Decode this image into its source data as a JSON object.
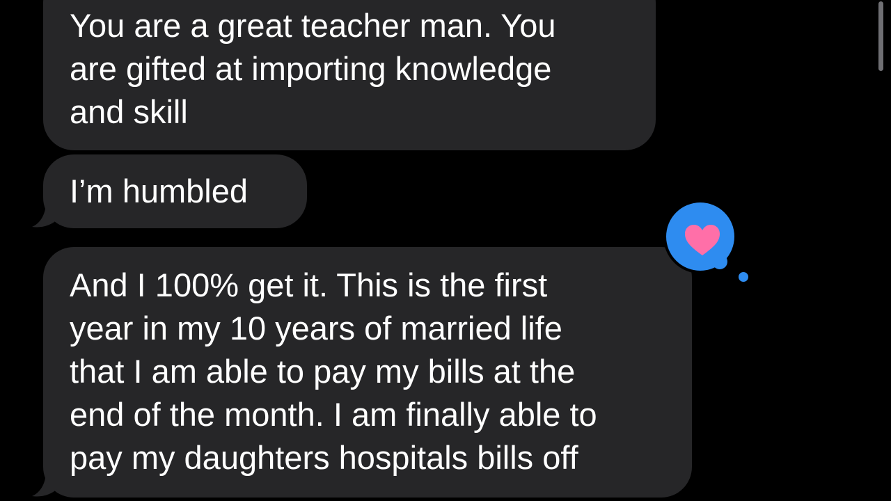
{
  "conversation": {
    "messages": [
      {
        "direction": "received",
        "lines": [
          "You are a great teacher man. You",
          "are gifted at importing knowledge",
          "and skill"
        ]
      },
      {
        "direction": "received",
        "lines": [
          "I’m humbled"
        ]
      },
      {
        "direction": "received",
        "lines": [
          "And I 100% get it. This is the first",
          "year in my 10 years of married life",
          "that I am able to pay my bills at the",
          "end of the month. I am finally able to",
          "pay my daughters hospitals bills off"
        ],
        "tapback": {
          "icon": "heart-icon",
          "bubble_color": "#2e8cf0",
          "heart_color": "#ff6fa8"
        }
      }
    ]
  },
  "colors": {
    "background": "#000000",
    "received_bubble": "#262628",
    "text": "#ffffff",
    "tapback_blue": "#2e8cf0",
    "heart_pink": "#ff6fa8",
    "scrollbar": "#6f6f73"
  }
}
